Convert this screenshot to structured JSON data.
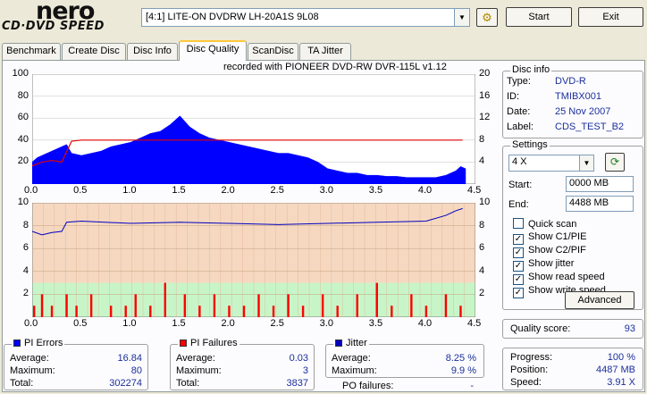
{
  "logo": {
    "brand": "nero",
    "product": "CD·DVD SPEED"
  },
  "toolbar": {
    "drive": "[4:1]  LITE-ON DVDRW LH-20A1S 9L08",
    "start_label": "Start",
    "exit_label": "Exit"
  },
  "tabs": [
    {
      "label": "Benchmark"
    },
    {
      "label": "Create Disc"
    },
    {
      "label": "Disc Info"
    },
    {
      "label": "Disc Quality"
    },
    {
      "label": "ScanDisc"
    },
    {
      "label": "TA Jitter"
    }
  ],
  "chart_caption": "recorded with PIONEER DVD-RW  DVR-115L v1.12",
  "colors": {
    "pie": "#0000ff",
    "pif": "#ff0000",
    "read_speed": "#e00000",
    "jitter": "#0000c0",
    "band_red": "#f6d8c0",
    "band_green": "#c8f5c8",
    "top_chart_bg": "#ffffff"
  },
  "chart_data": [
    {
      "type": "area",
      "series": [
        {
          "name": "PI",
          "x": [
            0.0,
            0.05,
            0.1,
            0.15,
            0.2,
            0.25,
            0.3,
            0.35,
            0.4,
            0.5,
            0.6,
            0.7,
            0.8,
            0.9,
            1.0,
            1.1,
            1.2,
            1.3,
            1.4,
            1.5,
            1.6,
            1.7,
            1.8,
            1.9,
            2.0,
            2.1,
            2.2,
            2.3,
            2.4,
            2.5,
            2.6,
            2.7,
            2.8,
            2.9,
            3.0,
            3.1,
            3.2,
            3.3,
            3.4,
            3.5,
            3.6,
            3.7,
            3.8,
            3.9,
            4.0,
            4.1,
            4.2,
            4.3,
            4.35,
            4.4
          ],
          "y": [
            20,
            24,
            26,
            28,
            30,
            32,
            34,
            36,
            28,
            26,
            28,
            30,
            34,
            36,
            38,
            42,
            46,
            48,
            54,
            62,
            52,
            46,
            42,
            40,
            38,
            36,
            34,
            32,
            30,
            28,
            28,
            26,
            24,
            20,
            14,
            12,
            10,
            10,
            8,
            8,
            7,
            7,
            6,
            6,
            6,
            6,
            8,
            12,
            16,
            14
          ]
        },
        {
          "name": "Read speed",
          "x": [
            0.0,
            0.1,
            0.2,
            0.3,
            0.4,
            0.5,
            1.0,
            1.5,
            2.0,
            2.5,
            3.0,
            3.5,
            4.0,
            4.37
          ],
          "y": [
            3.3,
            4.0,
            4.3,
            4.0,
            7.8,
            8.0,
            8.0,
            8.0,
            8.0,
            8.0,
            8.0,
            8.0,
            8.0,
            8.0
          ]
        }
      ],
      "xlim": [
        0,
        4.5
      ],
      "ylim": [
        0,
        100
      ],
      "y2lim": [
        0,
        20
      ],
      "yticks": [
        20,
        40,
        60,
        80,
        100
      ],
      "y2ticks": [
        4,
        8,
        12,
        16,
        20
      ],
      "xticks": [
        "0.0",
        "0.5",
        "1.0",
        "1.5",
        "2.0",
        "2.5",
        "3.0",
        "3.5",
        "4.0",
        "4.5"
      ]
    },
    {
      "type": "bar",
      "series": [
        {
          "name": "PIF",
          "x": [
            0.02,
            0.1,
            0.2,
            0.35,
            0.45,
            0.6,
            0.8,
            0.95,
            1.05,
            1.2,
            1.35,
            1.55,
            1.7,
            1.85,
            2.0,
            2.15,
            2.3,
            2.45,
            2.6,
            2.75,
            2.95,
            3.1,
            3.3,
            3.5,
            3.65,
            3.85,
            4.0,
            4.2,
            4.35
          ],
          "y": [
            1,
            2,
            1,
            2,
            1,
            2,
            1,
            1,
            2,
            1,
            3,
            2,
            1,
            2,
            1,
            1,
            2,
            1,
            2,
            1,
            2,
            1,
            2,
            3,
            1,
            2,
            1,
            2,
            1
          ]
        },
        {
          "name": "Jitter",
          "x": [
            0.0,
            0.1,
            0.2,
            0.3,
            0.35,
            0.5,
            1.0,
            1.5,
            2.0,
            2.5,
            3.0,
            3.5,
            4.0,
            4.2,
            4.3,
            4.37
          ],
          "y": [
            7.5,
            7.2,
            7.4,
            7.5,
            8.3,
            8.4,
            8.2,
            8.3,
            8.2,
            8.1,
            8.2,
            8.3,
            8.4,
            8.9,
            9.3,
            9.5
          ]
        }
      ],
      "xlim": [
        0,
        4.5
      ],
      "ylim": [
        0,
        10
      ],
      "y2lim": [
        0,
        10
      ],
      "yticks": [
        2,
        4,
        6,
        8,
        10
      ],
      "y2ticks": [
        2,
        4,
        6,
        8,
        10
      ],
      "xticks": [
        "0.0",
        "0.5",
        "1.0",
        "1.5",
        "2.0",
        "2.5",
        "3.0",
        "3.5",
        "4.0",
        "4.5"
      ]
    }
  ],
  "pi_errors": {
    "title": "PI Errors",
    "average_label": "Average:",
    "average": "16.84",
    "maximum_label": "Maximum:",
    "maximum": "80",
    "total_label": "Total:",
    "total": "302274"
  },
  "pi_failures": {
    "title": "PI Failures",
    "average_label": "Average:",
    "average": "0.03",
    "maximum_label": "Maximum:",
    "maximum": "3",
    "total_label": "Total:",
    "total": "3837"
  },
  "jitter": {
    "title": "Jitter",
    "average_label": "Average:",
    "average": "8.25 %",
    "maximum_label": "Maximum:",
    "maximum": "9.9 %",
    "po_label": "PO failures:",
    "po": "-"
  },
  "disc_info": {
    "title": "Disc info",
    "type_label": "Type:",
    "type": "DVD-R",
    "id_label": "ID:",
    "id": "TMIBX001",
    "date_label": "Date:",
    "date": "25 Nov 2007",
    "label_label": "Label:",
    "label": "CDS_TEST_B2"
  },
  "settings": {
    "title": "Settings",
    "speed": "4 X",
    "start_label": "Start:",
    "start": "0000 MB",
    "end_label": "End:",
    "end": "4488 MB",
    "checkboxes": [
      {
        "label": "Quick scan",
        "checked": false
      },
      {
        "label": "Show C1/PIE",
        "checked": true
      },
      {
        "label": "Show C2/PIF",
        "checked": true
      },
      {
        "label": "Show jitter",
        "checked": true
      },
      {
        "label": "Show read speed",
        "checked": true
      },
      {
        "label": "Show write speed",
        "checked": true
      }
    ],
    "advanced_label": "Advanced"
  },
  "quality": {
    "label": "Quality score:",
    "value": "93"
  },
  "progress": {
    "progress_label": "Progress:",
    "progress": "100 %",
    "position_label": "Position:",
    "position": "4487 MB",
    "speed_label": "Speed:",
    "speed": "3.91 X"
  }
}
